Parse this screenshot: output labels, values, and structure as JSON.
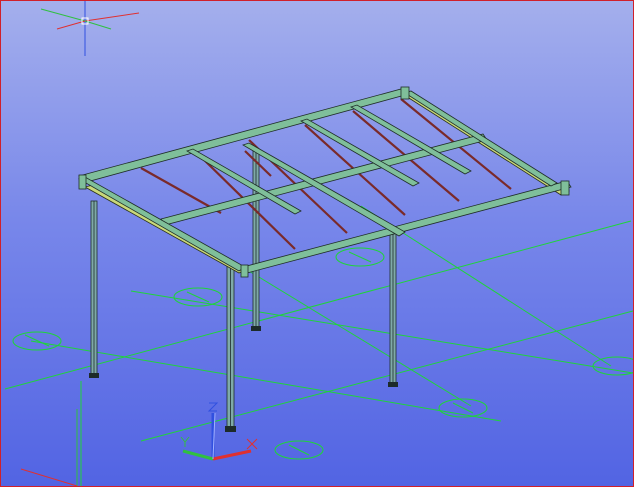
{
  "colors": {
    "background_top": "#a4afec",
    "background_bottom": "#5264e3",
    "border": "#d0202a",
    "grid": "#1fd43a",
    "steel_beam": "#7fbf9a",
    "steel_edge_beam": "#c9d87a",
    "joist": "#7a2a2a",
    "axis_x": "#e03030",
    "axis_y": "#30c040",
    "axis_z": "#3050e0"
  },
  "icons": [
    "ucs-icon",
    "crosshair-cursor-icon"
  ]
}
